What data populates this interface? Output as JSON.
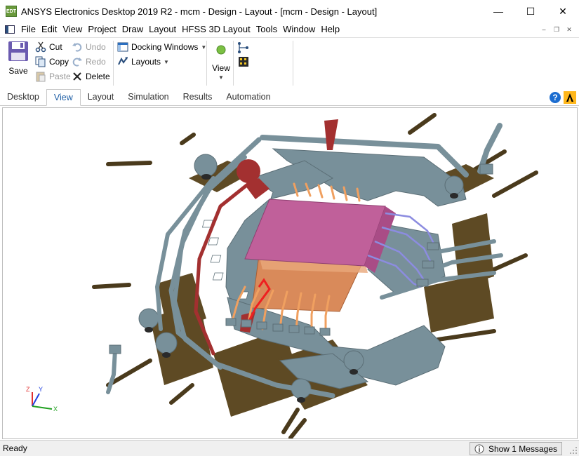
{
  "window": {
    "app_icon_text": "EDT",
    "title": "ANSYS Electronics Desktop 2019 R2 - mcm - Design - Layout - [mcm - Design - Layout]",
    "minimize": "—",
    "maximize": "☐",
    "close": "✕"
  },
  "menu": {
    "items": [
      "File",
      "Edit",
      "View",
      "Project",
      "Draw",
      "Layout",
      "HFSS 3D Layout",
      "Tools",
      "Window",
      "Help"
    ],
    "mdi_minimize": "–",
    "mdi_restore": "❐",
    "mdi_close": "✕"
  },
  "ribbon": {
    "save": "Save",
    "cut": "Cut",
    "copy": "Copy",
    "paste": "Paste",
    "undo": "Undo",
    "redo": "Redo",
    "delete": "Delete",
    "docking_windows": "Docking Windows",
    "layouts": "Layouts",
    "view": "View"
  },
  "tabs": {
    "items": [
      "Desktop",
      "View",
      "Layout",
      "Simulation",
      "Results",
      "Automation"
    ],
    "active": "View"
  },
  "axes": {
    "z": "Z",
    "y": "Y",
    "x": "X"
  },
  "status": {
    "text": "Ready",
    "messages_button": "Show 1 Messages"
  },
  "colors": {
    "substrate": "#5e4a24",
    "trace": "#78909a",
    "chip": "#c0609a",
    "die": "#d98a5a",
    "red_net": "#a33030",
    "orange_wire": "#f0a060",
    "purple_wire": "#8c8ce0"
  }
}
